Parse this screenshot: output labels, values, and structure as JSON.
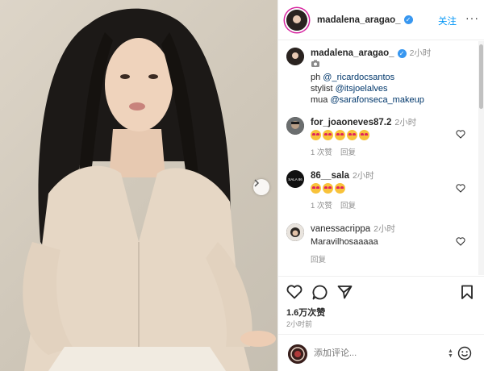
{
  "post_author": {
    "username": "madalena_aragao_",
    "follow_label": "关注",
    "more_label": "···"
  },
  "caption": {
    "username": "madalena_aragao_",
    "time": "2小时",
    "credit_lines": [
      {
        "prefix": "ph ",
        "mention": "@_ricardocsantos"
      },
      {
        "prefix": "stylist ",
        "mention": "@itsjoelalves"
      },
      {
        "prefix": "mua ",
        "mention": "@sarafonseca_makeup"
      }
    ]
  },
  "comments": [
    {
      "username": "for_joaoneves87.2",
      "time": "2小时",
      "emoji_count": 5,
      "likes_label": "1 次赞",
      "reply_label": "回复"
    },
    {
      "username": "86__sala",
      "time": "2小时",
      "emoji_count": 3,
      "likes_label": "1 次赞",
      "reply_label": "回复",
      "avatar_text": "SALA 86"
    },
    {
      "username": "vanessacrippa",
      "time": "2小时",
      "text": "Maravilhosaaaaa",
      "reply_label": "回复"
    }
  ],
  "footer": {
    "likes": "1.6万次赞",
    "post_time": "2小时前",
    "comment_placeholder": "添加评论..."
  },
  "colors": {
    "link": "#00376b",
    "follow_blue": "#0095f6",
    "verified_blue": "#3897f0",
    "muted": "#8e8e8e"
  },
  "icons": [
    "next-arrow-icon",
    "verified-icon",
    "heart-icon",
    "comment-icon",
    "share-icon",
    "bookmark-icon",
    "emoji-icon"
  ]
}
